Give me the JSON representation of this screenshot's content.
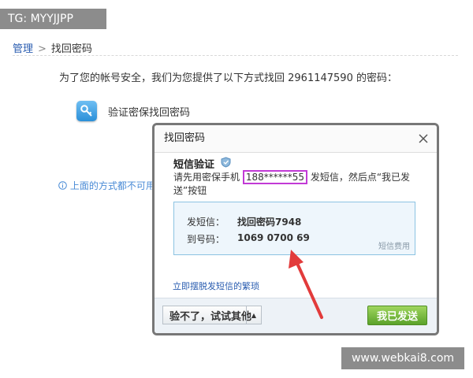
{
  "watermark_top": "TG: MYYJJPP",
  "watermark_bottom": "www.webkai8.com",
  "breadcrumb": {
    "parent": "管理",
    "separator": ">",
    "current": "找回密码"
  },
  "intro_text": "为了您的帐号安全，我们为您提供了以下方式找回 2961147590 的密码：",
  "method": {
    "icon": "key-icon",
    "label": "验证密保找回密码"
  },
  "hint_text": "上面的方式都不可用",
  "dialog": {
    "title": "找回密码",
    "sub_heading": "短信验证",
    "instruction_before": "请先用密保手机 ",
    "phone_masked": "188******55",
    "instruction_after": " 发短信，然后点“我已发送”按钮",
    "send_label": "发短信：",
    "send_value": "找回密码7948",
    "to_label": "到号码：",
    "to_value": "1069 0700 69",
    "fee_text": "短信费用",
    "link_text": "立即摆脱发短信的繁琐",
    "try_other_button": "验不了，试试其他",
    "sent_button": "我已发送"
  },
  "colors": {
    "phone_highlight": "#c23ad6",
    "confirm_button": "#6ab236",
    "annotation_arrow": "#e23b3b"
  }
}
